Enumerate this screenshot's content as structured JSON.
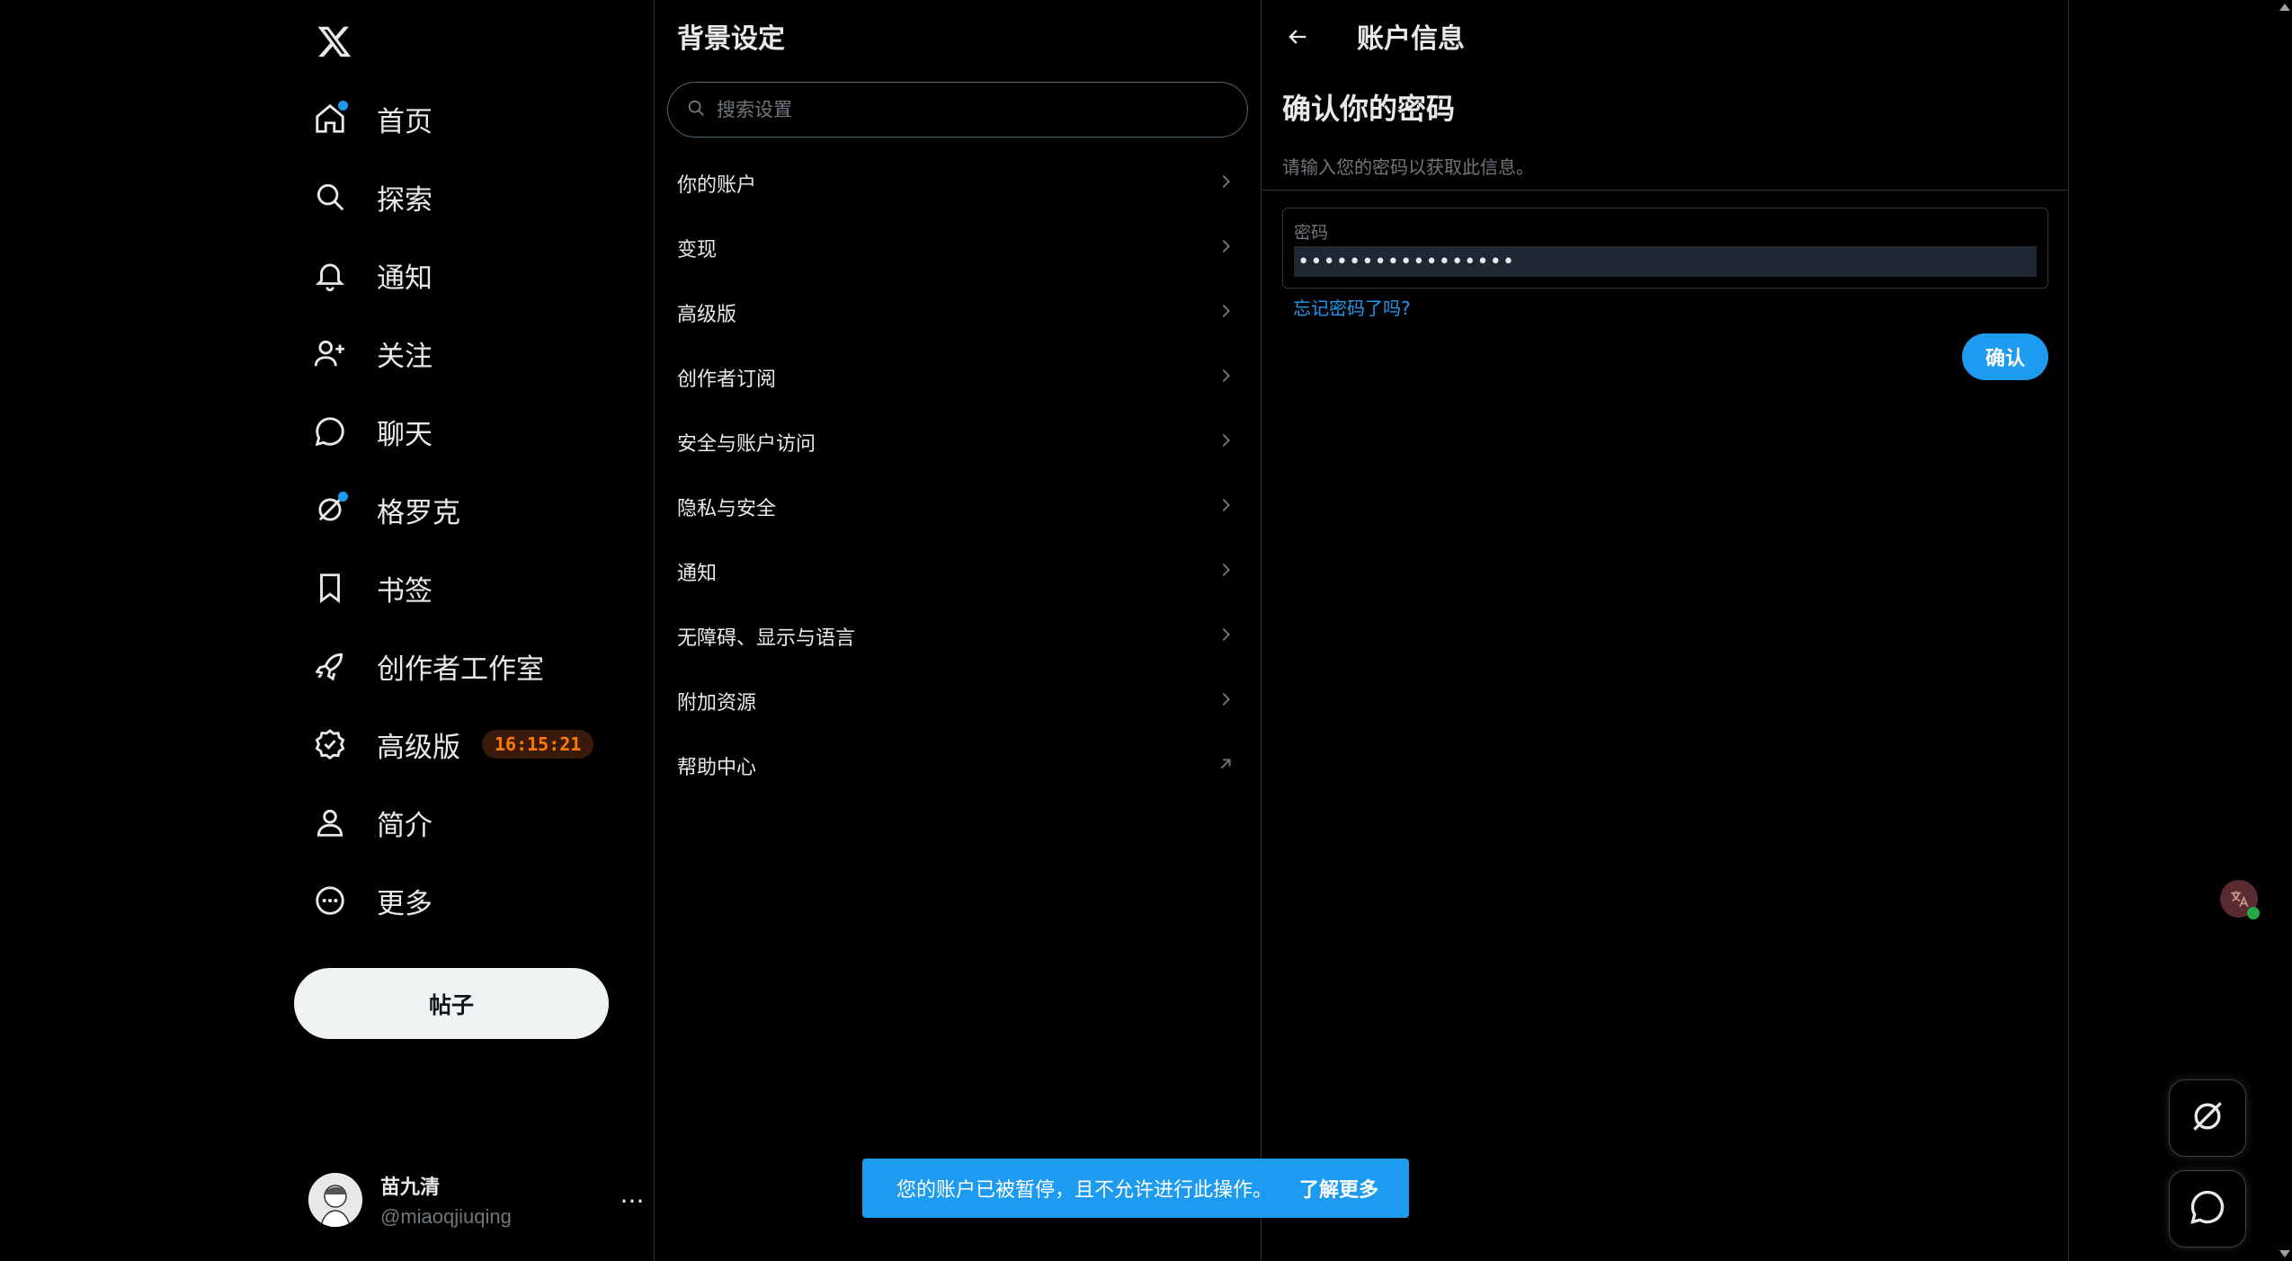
{
  "nav": {
    "items": [
      {
        "label": "首页",
        "icon": "home-icon",
        "dot": true
      },
      {
        "label": "探索",
        "icon": "search-icon",
        "dot": false
      },
      {
        "label": "通知",
        "icon": "bell-icon",
        "dot": false
      },
      {
        "label": "关注",
        "icon": "follow-icon",
        "dot": false
      },
      {
        "label": "聊天",
        "icon": "chat-icon",
        "dot": false
      },
      {
        "label": "格罗克",
        "icon": "grok-icon",
        "dot": true
      },
      {
        "label": "书签",
        "icon": "bookmark-icon",
        "dot": false
      },
      {
        "label": "创作者工作室",
        "icon": "rocket-icon",
        "dot": false
      },
      {
        "label": "高级版",
        "icon": "verified-icon",
        "dot": false,
        "badge": "16:15:21"
      },
      {
        "label": "简介",
        "icon": "person-icon",
        "dot": false
      },
      {
        "label": "更多",
        "icon": "more-circle-icon",
        "dot": false
      }
    ],
    "post_label": "帖子"
  },
  "profile": {
    "name": "苗九清",
    "handle": "@miaoqjiuqing",
    "more": "···"
  },
  "settings": {
    "title": "背景设定",
    "search_placeholder": "搜索设置",
    "rows": [
      {
        "label": "你的账户",
        "icon": "chevron-right-icon"
      },
      {
        "label": "变现",
        "icon": "chevron-right-icon"
      },
      {
        "label": "高级版",
        "icon": "chevron-right-icon"
      },
      {
        "label": "创作者订阅",
        "icon": "chevron-right-icon"
      },
      {
        "label": "安全与账户访问",
        "icon": "chevron-right-icon"
      },
      {
        "label": "隐私与安全",
        "icon": "chevron-right-icon"
      },
      {
        "label": "通知",
        "icon": "chevron-right-icon"
      },
      {
        "label": "无障碍、显示与语言",
        "icon": "chevron-right-icon"
      },
      {
        "label": "附加资源",
        "icon": "chevron-right-icon"
      },
      {
        "label": "帮助中心",
        "icon": "external-link-icon"
      }
    ]
  },
  "account": {
    "title": "账户信息",
    "heading": "确认你的密码",
    "subtitle": "请输入您的密码以获取此信息。",
    "password_label": "密码",
    "password_value": "•••••••••••••••••",
    "forgot_label": "忘记密码了吗?",
    "confirm_label": "确认"
  },
  "toast": {
    "message": "您的账户已被暂停，且不允许进行此操作。",
    "link": "了解更多"
  },
  "colors": {
    "accent": "#1d9bf0",
    "background": "#000000",
    "border": "#2f3336",
    "badge_text": "#ff7a00"
  }
}
